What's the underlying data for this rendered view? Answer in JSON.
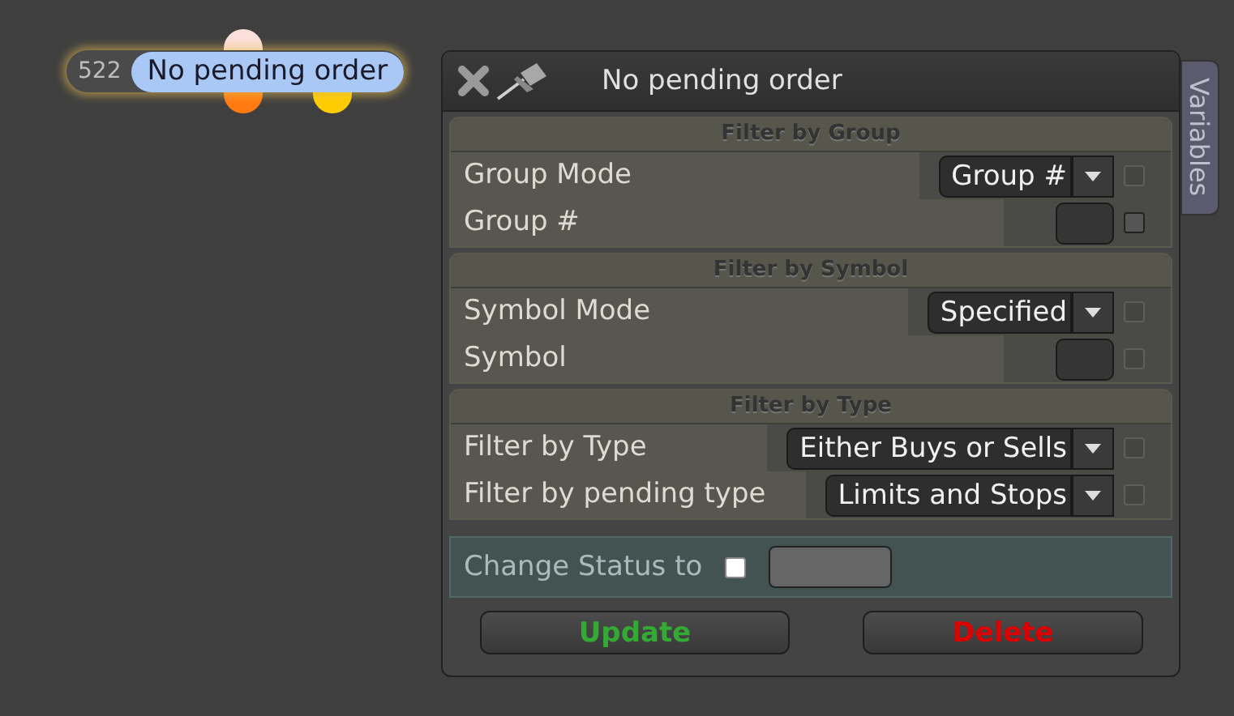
{
  "node": {
    "count": "522",
    "label": "No pending order",
    "top_ports": [
      {
        "color": "#fde0dc"
      }
    ],
    "bottom_ports": [
      {
        "color": "#ff7a10"
      },
      {
        "color": "#ffcc00"
      }
    ]
  },
  "panel": {
    "title": "No pending order",
    "side_tab": "Variables",
    "sections": [
      {
        "title": "Filter by Group",
        "rows": [
          {
            "kind": "dropdown",
            "label": "Group Mode",
            "value": "Group #",
            "checkbox": {
              "checked": false,
              "disabled": true
            }
          },
          {
            "kind": "input",
            "label": "Group #",
            "checkbox": {
              "checked": false,
              "disabled": false
            }
          }
        ]
      },
      {
        "title": "Filter by Symbol",
        "rows": [
          {
            "kind": "dropdown",
            "label": "Symbol Mode",
            "value": "Specified",
            "checkbox": {
              "checked": false,
              "disabled": true
            }
          },
          {
            "kind": "input",
            "label": "Symbol",
            "checkbox": {
              "checked": false,
              "disabled": true
            }
          }
        ]
      },
      {
        "title": "Filter by Type",
        "rows": [
          {
            "kind": "dropdown",
            "label": "Filter by Type",
            "value": "Either Buys or Sells",
            "checkbox": {
              "checked": false,
              "disabled": true
            }
          },
          {
            "kind": "dropdown",
            "label": "Filter by pending type",
            "value": "Limits and Stops",
            "checkbox": {
              "checked": false,
              "disabled": true
            }
          }
        ]
      }
    ],
    "status": {
      "label": "Change Status to",
      "checked": false
    },
    "buttons": [
      {
        "label": "Update",
        "color": "#33aa33"
      },
      {
        "label": "Delete",
        "color": "#dd0000"
      }
    ]
  }
}
